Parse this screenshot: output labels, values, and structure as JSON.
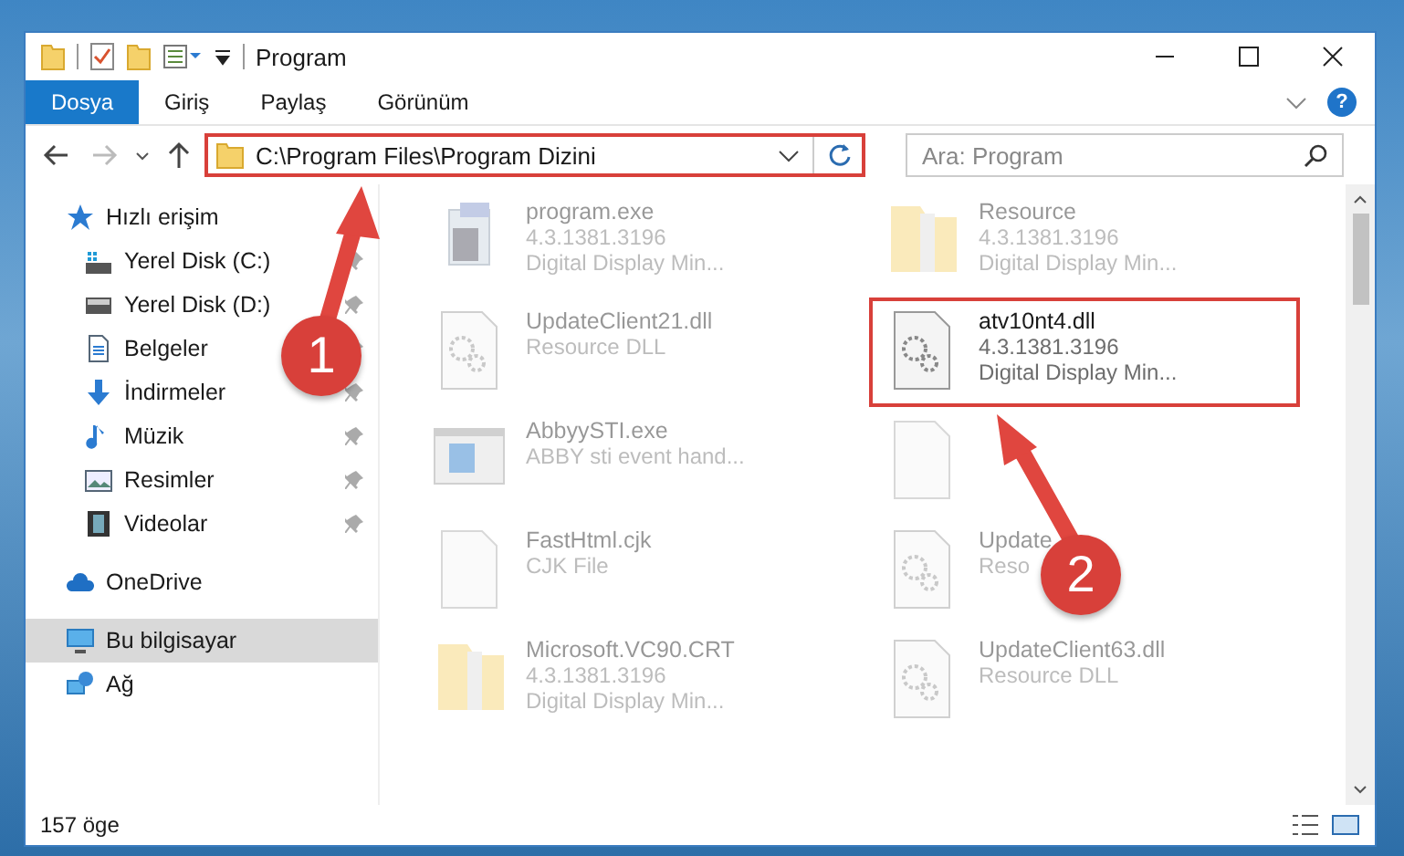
{
  "window": {
    "title": "Program"
  },
  "help": {
    "label": "?"
  },
  "ribbon_tabs": [
    {
      "label": "Dosya",
      "selected": true
    },
    {
      "label": "Giriş",
      "selected": false
    },
    {
      "label": "Paylaş",
      "selected": false
    },
    {
      "label": "Görünüm",
      "selected": false
    }
  ],
  "address": {
    "path": "C:\\Program Files\\Program Dizini",
    "marked": true
  },
  "search": {
    "placeholder": "Ara: Program"
  },
  "sidebar": {
    "items": [
      {
        "label": "Hızlı erişim",
        "kind": "star",
        "selected": false,
        "children": [
          {
            "label": "Yerel Disk (C:)",
            "kind": "drive-win",
            "pinned": true,
            "selected": false
          },
          {
            "label": "Yerel Disk (D:)",
            "kind": "drive",
            "pinned": true,
            "selected": false
          },
          {
            "label": "Belgeler",
            "kind": "document",
            "pinned": true,
            "selected": false
          },
          {
            "label": "İndirmeler",
            "kind": "download",
            "pinned": true,
            "selected": false
          },
          {
            "label": "Müzik",
            "kind": "music",
            "pinned": true,
            "selected": false
          },
          {
            "label": "Resimler",
            "kind": "pictures",
            "pinned": true,
            "selected": false
          },
          {
            "label": "Videolar",
            "kind": "video",
            "pinned": true,
            "selected": false
          }
        ]
      },
      {
        "label": "OneDrive",
        "kind": "cloud",
        "selected": false
      },
      {
        "label": "Bu bilgisayar",
        "kind": "computer",
        "selected": true
      },
      {
        "label": "Ağ",
        "kind": "network",
        "selected": false
      }
    ]
  },
  "files": [
    {
      "name": "program.exe",
      "details": [
        "4.3.1381.3196",
        "Digital Display Min..."
      ],
      "kind": "setup",
      "faded": true,
      "marked": false
    },
    {
      "name": "Resource",
      "details": [
        "4.3.1381.3196",
        "Digital Display Min..."
      ],
      "kind": "folder",
      "faded": true,
      "marked": false
    },
    {
      "name": "UpdateClient21.dll",
      "details": [
        "Resource DLL"
      ],
      "kind": "dll",
      "faded": true,
      "marked": false
    },
    {
      "name": "atv10nt4.dll",
      "details": [
        "4.3.1381.3196",
        "Digital Display Min..."
      ],
      "kind": "dll",
      "faded": false,
      "marked": true
    },
    {
      "name": "AbbyySTI.exe",
      "details": [
        "ABBY sti event hand..."
      ],
      "kind": "app",
      "faded": true,
      "marked": false
    },
    {
      "kind": "file",
      "faded": true,
      "marked": false
    },
    {
      "name": "FastHtml.cjk",
      "details": [
        "CJK File"
      ],
      "kind": "file",
      "faded": true,
      "marked": false
    },
    {
      "name": "Update",
      "details": [
        "Reso"
      ],
      "kind": "dll",
      "faded": true,
      "marked": false
    },
    {
      "name": "Microsoft.VC90.CRT",
      "details": [
        "4.3.1381.3196",
        "Digital Display Min..."
      ],
      "kind": "folder",
      "faded": true,
      "marked": false
    },
    {
      "name": "UpdateClient63.dll",
      "details": [
        "Resource DLL"
      ],
      "kind": "dll",
      "faded": true,
      "marked": false
    }
  ],
  "status_bar": {
    "count": "157 öge"
  },
  "annotations": [
    {
      "label": "1"
    },
    {
      "label": "2"
    }
  ]
}
